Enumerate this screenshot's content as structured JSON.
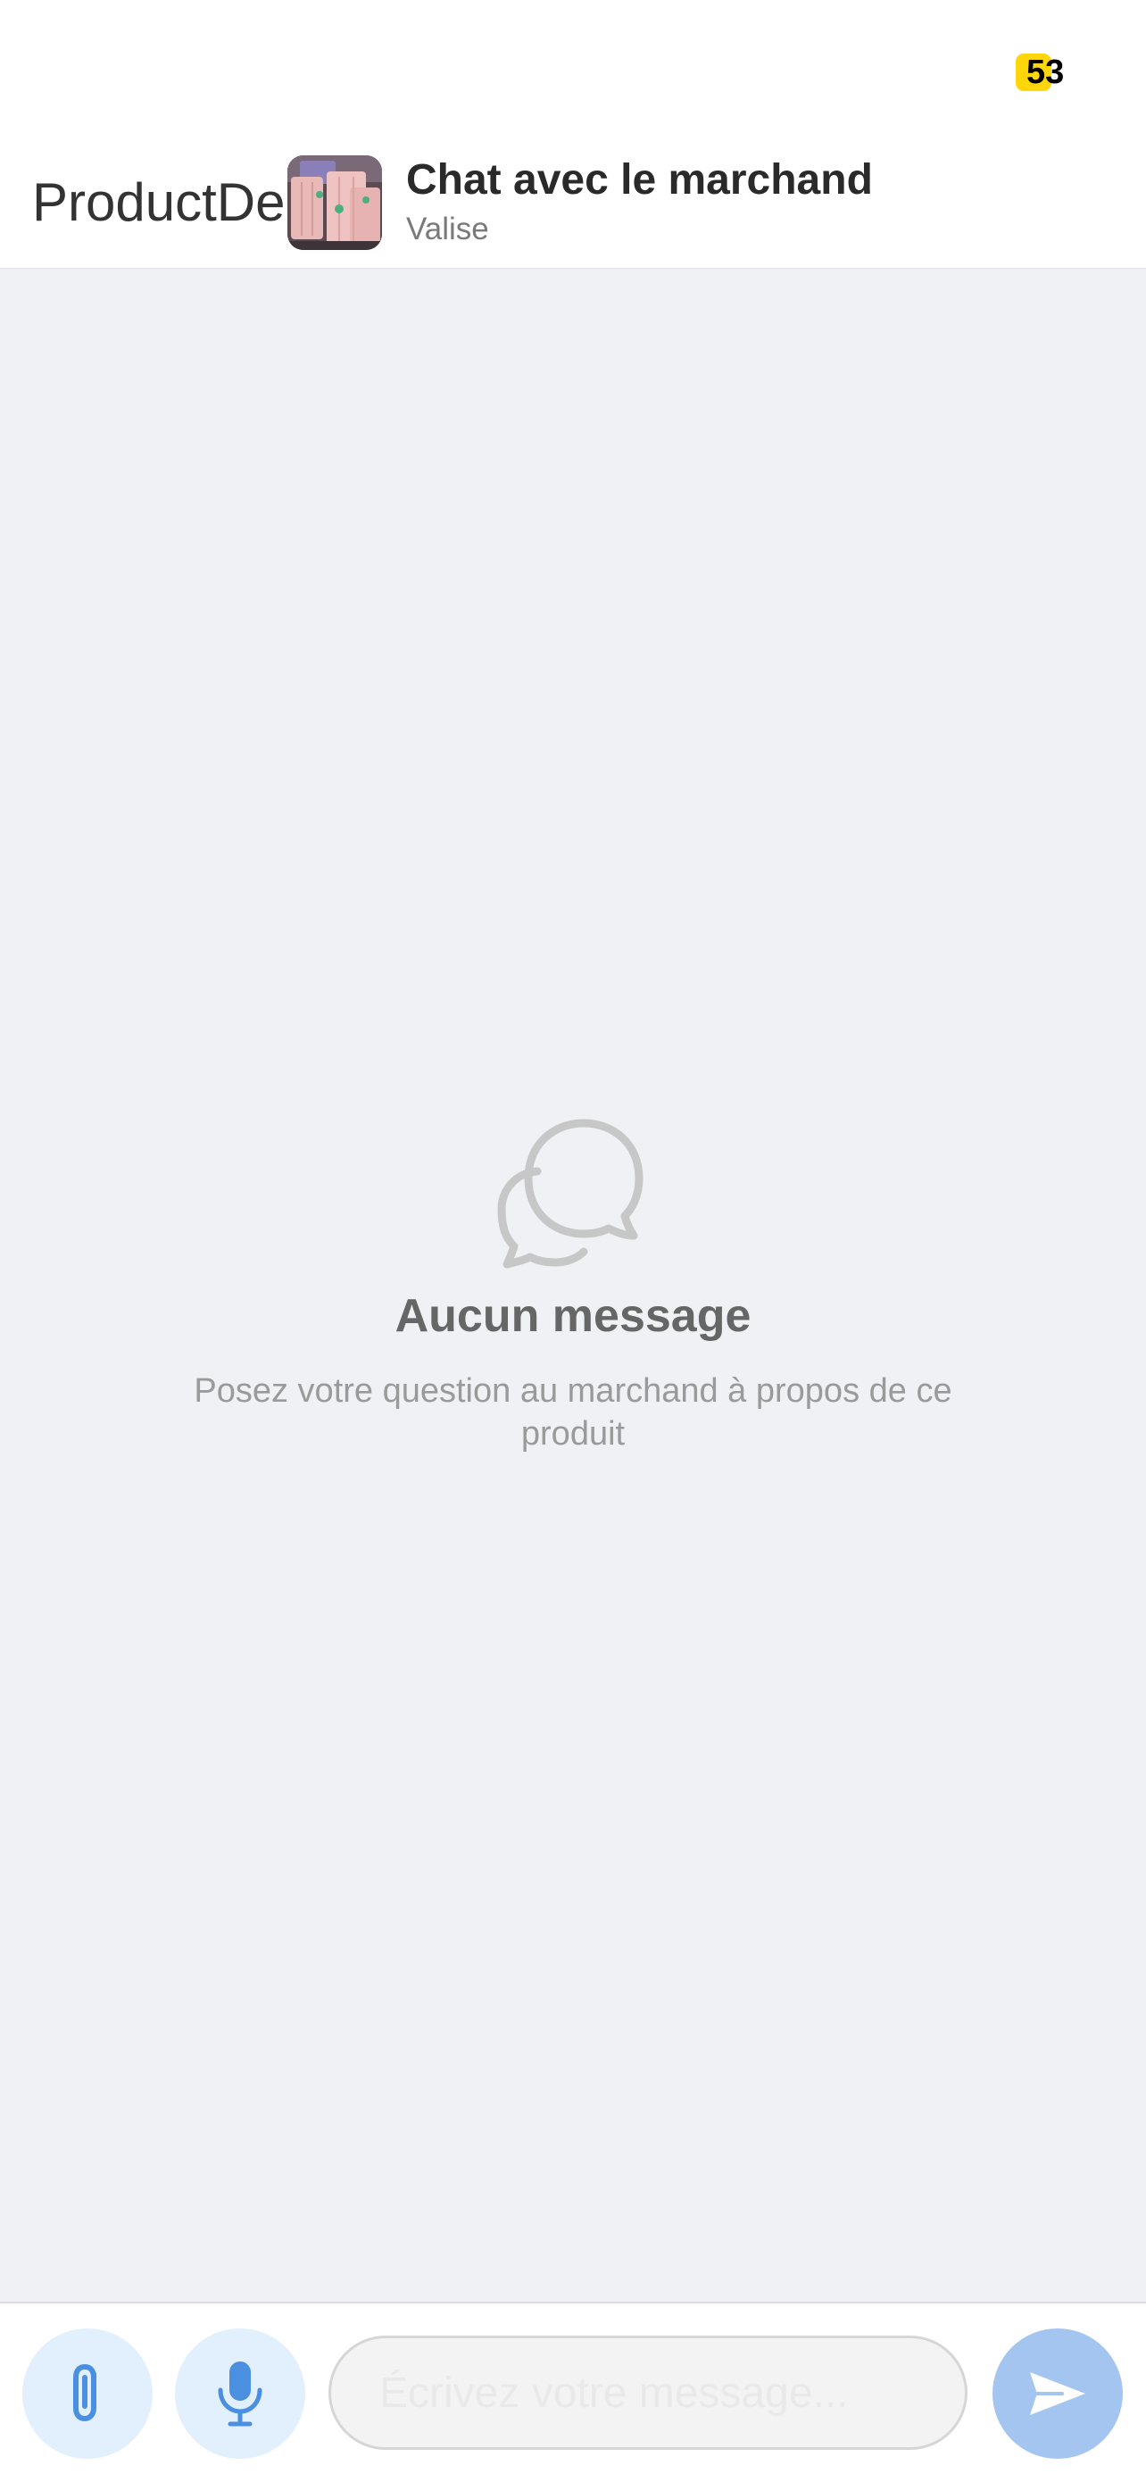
{
  "status_bar": {
    "battery_level": "53",
    "battery_color": "#ffd60a"
  },
  "header": {
    "back_label": "ProductDetails",
    "title": "Chat avec le marchand",
    "subtitle": "Valise",
    "back_icon": "chevron-left-icon",
    "thumbnail": "product-image"
  },
  "empty_state": {
    "icon": "chat-bubbles-icon",
    "title": "Aucun message",
    "description": "Posez votre question au marchand à propos de ce produit"
  },
  "composer": {
    "attach_icon": "paperclip-icon",
    "mic_icon": "microphone-icon",
    "send_icon": "send-icon",
    "placeholder": "Écrivez votre message...",
    "value": "",
    "accent_color": "#4a8fe0"
  }
}
